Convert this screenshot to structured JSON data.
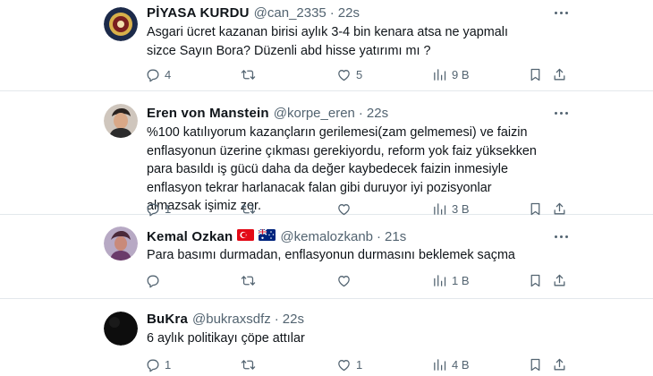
{
  "tweets": [
    {
      "name": "PİYASA KURDU",
      "handle": "@can_2335",
      "time": "22s",
      "text": "Asgari ücret kazanan birisi aylık 3-4 bin kenara atsa ne yapmalı sizce Sayın Bora? Düzenli abd hisse yatırımı mı ?",
      "replies": "4",
      "retweets": "",
      "likes": "5",
      "views": "9 B"
    },
    {
      "name": "Eren von Manstein",
      "handle": "@korpe_eren",
      "time": "22s",
      "text": "%100 katılıyorum kazançların gerilemesi(zam gelmemesi) ve faizin enflasyonun üzerine çıkması gerekiyordu, reform yok faiz yüksekken para basıldı iş gücü daha da değer kaybedecek faizin inmesiyle enflasyon tekrar harlanacak falan gibi duruyor iyi pozisyonlar almazsak işimiz zor.",
      "replies": "1",
      "retweets": "",
      "likes": "",
      "views": "3 B"
    },
    {
      "name": "Kemal Ozkan",
      "handle": "@kemalozkanb",
      "time": "21s",
      "text": "Para basımı durmadan, enflasyonun durmasını beklemek saçma",
      "replies": "",
      "retweets": "",
      "likes": "",
      "views": "1 B"
    },
    {
      "name": "BuKra",
      "handle": "@bukraxsdfz",
      "time": "22s",
      "text": "6 aylık politikayı çöpe attılar",
      "replies": "1",
      "retweets": "",
      "likes": "1",
      "views": "4 B"
    }
  ],
  "icons": {
    "reply": "reply-icon",
    "retweet": "retweet-icon",
    "like": "like-icon",
    "views": "views-icon",
    "bookmark": "bookmark-icon",
    "share": "share-icon",
    "more": "more-icon"
  },
  "colors": {
    "text": "#0f1419",
    "secondary": "#536471",
    "divider": "#e3e8ec"
  }
}
